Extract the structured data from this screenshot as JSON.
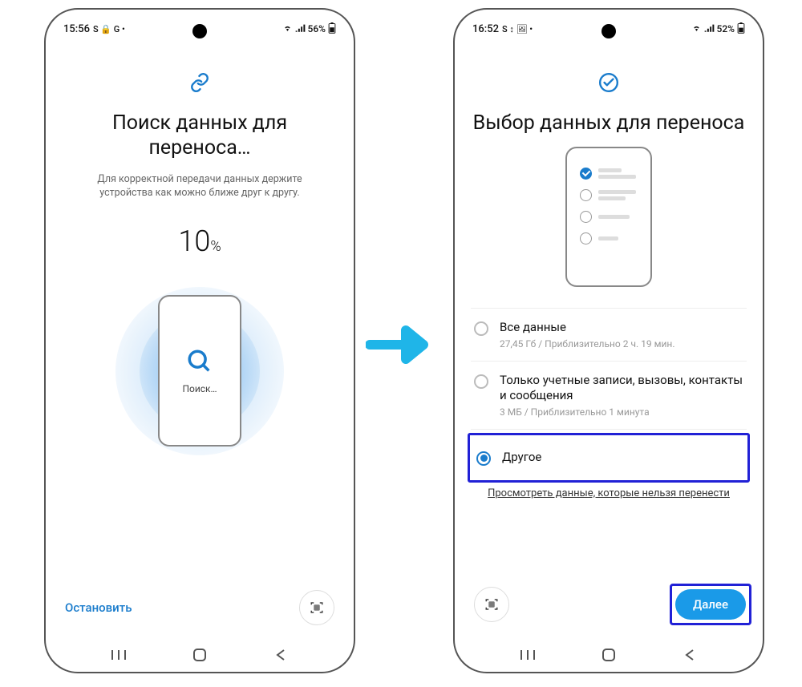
{
  "left": {
    "status": {
      "time": "15:56",
      "icons": "S 🔒 G •",
      "battery": "56%"
    },
    "title": "Поиск данных для переноса…",
    "subtitle": "Для корректной передачи данных держите устройства как можно ближе друг к другу.",
    "progress_value": "10",
    "progress_unit": "%",
    "search_label": "Поиск…",
    "stop_button": "Остановить"
  },
  "right": {
    "status": {
      "time": "16:52",
      "icons": "S ↕ 🖼 •",
      "battery": "52%"
    },
    "title": "Выбор данных для переноса",
    "options": [
      {
        "title": "Все данные",
        "subtitle": "27,45 Гб / Приблизительно 2 ч. 19 мин.",
        "selected": false
      },
      {
        "title": "Только учетные записи, вызовы, контакты и сообщения",
        "subtitle": "3 МБ / Приблизительно 1 минута",
        "selected": false
      },
      {
        "title": "Другое",
        "subtitle": "",
        "selected": true
      }
    ],
    "link": "Просмотреть данные, которые нельзя перенести",
    "next_button": "Далее"
  }
}
